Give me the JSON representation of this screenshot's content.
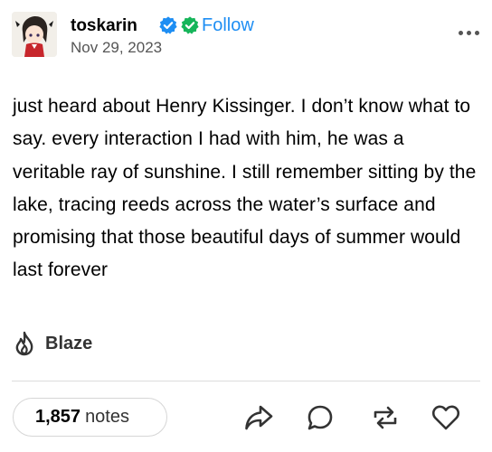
{
  "post": {
    "blog_name": "toskarin",
    "follow_label": "Follow",
    "date": "Nov 29, 2023",
    "text": "just heard about Henry Kissinger. I don’t know what to say. every interaction I had with him, he was a veritable ray of sunshine. I still remember sitting by the lake, tracing reeds across the water’s surface and promising that those beautiful days of summer would last forever",
    "blaze_label": "Blaze"
  },
  "footer": {
    "notes_count": "1,857",
    "notes_label": "notes"
  },
  "colors": {
    "follow": "#1e8ef3",
    "verified_blue": "#1e8ef3",
    "verified_green": "#16b55a",
    "icon": "#333333"
  },
  "icons": [
    "verified-badge-icon",
    "verified-badge-green-icon",
    "more-options-icon",
    "flame-icon",
    "share-icon",
    "reply-icon",
    "reblog-icon",
    "like-icon"
  ]
}
